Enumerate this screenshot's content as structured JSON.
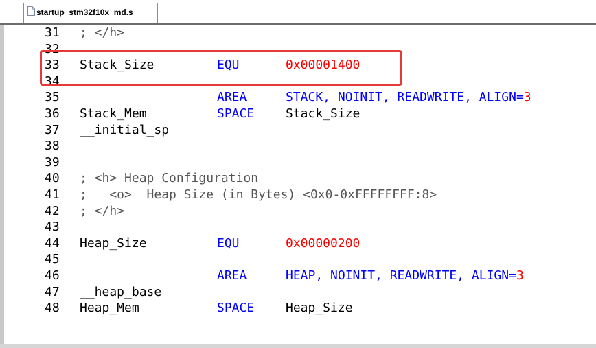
{
  "tab": {
    "filename": "startup_stm32f10x_md.s"
  },
  "lines": [
    {
      "num": "31",
      "comment": "; </h>"
    },
    {
      "num": "32"
    },
    {
      "num": "33",
      "label": "Stack_Size",
      "kw": "EQU",
      "value": "0x00001400"
    },
    {
      "num": "34"
    },
    {
      "num": "35",
      "kw": "AREA",
      "operands": "STACK, NOINIT, READWRITE, ALIGN=",
      "num_suffix": "3"
    },
    {
      "num": "36",
      "label": "Stack_Mem",
      "kw": "SPACE",
      "operands": "Stack_Size"
    },
    {
      "num": "37",
      "label": "__initial_sp"
    },
    {
      "num": "38"
    },
    {
      "num": "39"
    },
    {
      "num": "40",
      "comment": "; <h> Heap Configuration"
    },
    {
      "num": "41",
      "comment": ";   <o>  Heap Size (in Bytes) <0x0-0xFFFFFFFF:8>"
    },
    {
      "num": "42",
      "comment": "; </h>"
    },
    {
      "num": "43"
    },
    {
      "num": "44",
      "label": "Heap_Size",
      "kw": "EQU",
      "value": "0x00000200"
    },
    {
      "num": "45"
    },
    {
      "num": "46",
      "kw": "AREA",
      "operands": "HEAP, NOINIT, READWRITE, ALIGN=",
      "num_suffix": "3"
    },
    {
      "num": "47",
      "label": "__heap_base"
    },
    {
      "num": "48",
      "label": "Heap_Mem",
      "kw": "SPACE",
      "operands": "Heap_Size"
    }
  ],
  "colors": {
    "keyword": "#0000ff",
    "number": "#ff0000",
    "highlight": "#e53935"
  }
}
